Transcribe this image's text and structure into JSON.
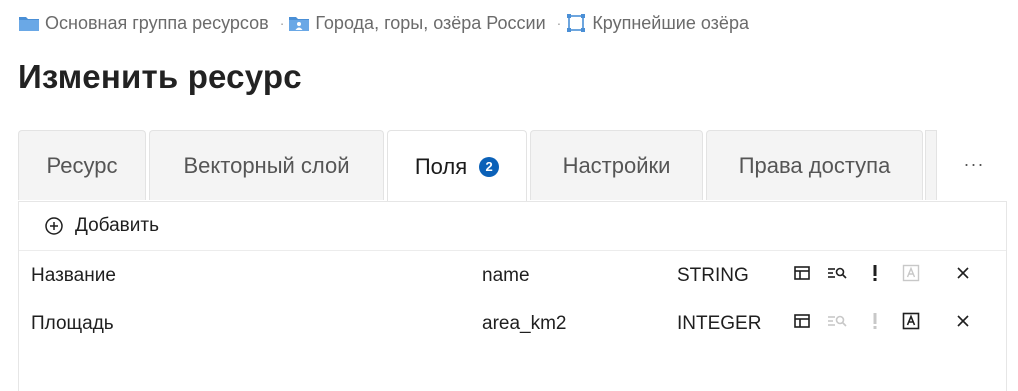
{
  "breadcrumb": {
    "items": [
      {
        "label": "Основная группа ресурсов",
        "icon": "folder-icon"
      },
      {
        "label": "Города, горы, озёра России",
        "icon": "folder-person-icon"
      },
      {
        "label": "Крупнейшие озёра",
        "icon": "vector-layer-icon"
      }
    ],
    "separator": "·"
  },
  "page": {
    "title": "Изменить ресурс"
  },
  "tabs": [
    {
      "label": "Ресурс",
      "active": false
    },
    {
      "label": "Векторный слой",
      "active": false
    },
    {
      "label": "Поля",
      "active": true,
      "badge": "2"
    },
    {
      "label": "Настройки",
      "active": false
    },
    {
      "label": "Права доступа",
      "active": false
    }
  ],
  "tabs_more": "···",
  "toolbar": {
    "add_label": "Добавить"
  },
  "fields": [
    {
      "display_name": "Название",
      "keyname": "name",
      "datatype": "STRING",
      "grid_visibility": true,
      "text_search": true,
      "required": true,
      "label_field": false
    },
    {
      "display_name": "Площадь",
      "keyname": "area_km2",
      "datatype": "INTEGER",
      "grid_visibility": true,
      "text_search": false,
      "required": false,
      "label_field": true
    }
  ],
  "colors": {
    "accent": "#0b61b8",
    "folder": "#4a8fd6",
    "icon_active": "#1f1f1f",
    "icon_inactive": "#c8c8c8"
  }
}
